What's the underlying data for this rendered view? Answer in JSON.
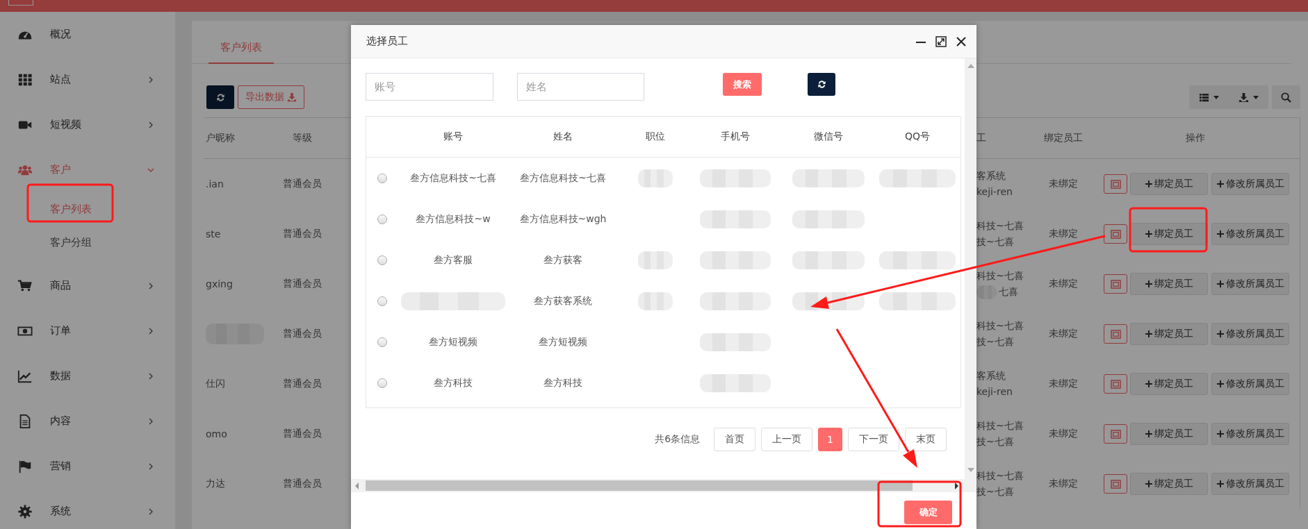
{
  "sidebar": {
    "items": [
      {
        "label": "概况",
        "kind": "link",
        "selected": false
      },
      {
        "label": "站点",
        "kind": "group",
        "expanded": false,
        "selected": false
      },
      {
        "label": "短视频",
        "kind": "group",
        "expanded": false,
        "selected": false
      },
      {
        "label": "客户",
        "kind": "group",
        "expanded": true,
        "selected": true,
        "children": [
          {
            "label": "客户列表",
            "selected": true
          },
          {
            "label": "客户分组",
            "selected": false
          }
        ]
      },
      {
        "label": "商品",
        "kind": "group",
        "expanded": false,
        "selected": false
      },
      {
        "label": "订单",
        "kind": "group",
        "expanded": false,
        "selected": false
      },
      {
        "label": "数据",
        "kind": "group",
        "expanded": false,
        "selected": false
      },
      {
        "label": "内容",
        "kind": "group",
        "expanded": false,
        "selected": false
      },
      {
        "label": "营销",
        "kind": "group",
        "expanded": false,
        "selected": false
      },
      {
        "label": "系统",
        "kind": "group",
        "expanded": false,
        "selected": false
      }
    ]
  },
  "tabs": [
    {
      "label": "客户列表",
      "selected": true
    }
  ],
  "toolbar": {
    "export_label": "导出数据"
  },
  "table": {
    "columns": [
      "户昵称",
      "等级",
      "工",
      "绑定员工",
      "操作"
    ],
    "rows": [
      {
        "nickname": ".ian",
        "nickname_redacted": false,
        "level": "普通会员",
        "owner": [
          "客系统",
          "keji-ren"
        ],
        "owner_blurred": false,
        "binding": "未绑定",
        "actions": [
          "绑定员工",
          "修改所属员工"
        ]
      },
      {
        "nickname": "ste",
        "nickname_redacted": false,
        "level": "普通会员",
        "owner": [
          "科技~七喜",
          "技~七喜"
        ],
        "owner_blurred": false,
        "binding": "未绑定",
        "actions": [
          "绑定员工",
          "修改所属员工"
        ]
      },
      {
        "nickname": "gxing",
        "nickname_redacted": false,
        "level": "普通会员",
        "owner": [
          "科技~七喜",
          "七喜"
        ],
        "owner_blurred": true,
        "binding": "未绑定",
        "actions": [
          "绑定员工",
          "修改所属员工"
        ]
      },
      {
        "nickname_redacted": true,
        "level": "普通会员",
        "owner": [
          "科技~七喜",
          "技~七喜"
        ],
        "owner_blurred": false,
        "binding": "未绑定",
        "actions": [
          "绑定员工",
          "修改所属员工"
        ]
      },
      {
        "nickname": "仕闪",
        "nickname_redacted": false,
        "level": "普通会员",
        "owner": [
          "客系统",
          "keji-ren"
        ],
        "owner_blurred": false,
        "binding": "未绑定",
        "actions": [
          "绑定员工",
          "修改所属员工"
        ]
      },
      {
        "nickname": "omo",
        "nickname_redacted": false,
        "level": "普通会员",
        "owner": [
          "科技~七喜",
          "技~七喜"
        ],
        "owner_blurred": false,
        "binding": "未绑定",
        "actions": [
          "绑定员工",
          "修改所属员工"
        ]
      },
      {
        "nickname": "力达",
        "nickname_redacted": false,
        "level": "普通会员",
        "owner": [
          "科技~七喜",
          "技~七喜"
        ],
        "owner_blurred": false,
        "binding": "未绑定",
        "actions": [
          "绑定员工",
          "修改所属员工"
        ]
      }
    ]
  },
  "modal": {
    "title": "选择员工",
    "filters": [
      {
        "placeholder": "账号"
      },
      {
        "placeholder": "姓名"
      }
    ],
    "search_label": "搜索",
    "columns": [
      "账号",
      "姓名",
      "职位",
      "手机号",
      "微信号",
      "QQ号"
    ],
    "rows": [
      {
        "selected": false,
        "cells": [
          {
            "kind": "text",
            "text": "叁方信息科技~七喜"
          },
          {
            "kind": "text",
            "text": "叁方信息科技~七喜"
          },
          {
            "kind": "blurred"
          },
          {
            "kind": "blurred"
          },
          {
            "kind": "blurred"
          },
          {
            "kind": "blurred"
          }
        ]
      },
      {
        "selected": false,
        "cells": [
          {
            "kind": "text",
            "text": "叁方信息科技~w"
          },
          {
            "kind": "text",
            "text": "叁方信息科技~wgh"
          },
          {
            "kind": "empty"
          },
          {
            "kind": "blurred"
          },
          {
            "kind": "blurred"
          },
          {
            "kind": "empty"
          }
        ]
      },
      {
        "selected": false,
        "cells": [
          {
            "kind": "text",
            "text": "叁方客服"
          },
          {
            "kind": "text",
            "text": "叁方获客"
          },
          {
            "kind": "blurred"
          },
          {
            "kind": "blurred"
          },
          {
            "kind": "blurred"
          },
          {
            "kind": "blurred"
          }
        ]
      },
      {
        "selected": false,
        "cells": [
          {
            "kind": "blurred"
          },
          {
            "kind": "text",
            "text": "叁方获客系统"
          },
          {
            "kind": "blurred"
          },
          {
            "kind": "blurred"
          },
          {
            "kind": "blurred"
          },
          {
            "kind": "blurred"
          }
        ]
      },
      {
        "selected": false,
        "cells": [
          {
            "kind": "text",
            "text": "叁方短视频"
          },
          {
            "kind": "text",
            "text": "叁方短视频"
          },
          {
            "kind": "empty"
          },
          {
            "kind": "blurred"
          },
          {
            "kind": "empty"
          },
          {
            "kind": "empty"
          }
        ]
      },
      {
        "selected": false,
        "cells": [
          {
            "kind": "text",
            "text": "叁方科技"
          },
          {
            "kind": "text",
            "text": "叁方科技"
          },
          {
            "kind": "empty"
          },
          {
            "kind": "blurred"
          },
          {
            "kind": "empty"
          },
          {
            "kind": "empty"
          }
        ]
      }
    ],
    "pagination": {
      "summary": "共6条信息",
      "buttons": [
        {
          "label": "首页",
          "selected": false
        },
        {
          "label": "上一页",
          "selected": false
        },
        {
          "label": "1",
          "selected": true
        },
        {
          "label": "下一页",
          "selected": false
        },
        {
          "label": "末页",
          "selected": false
        }
      ]
    },
    "confirm_label": "确定"
  }
}
